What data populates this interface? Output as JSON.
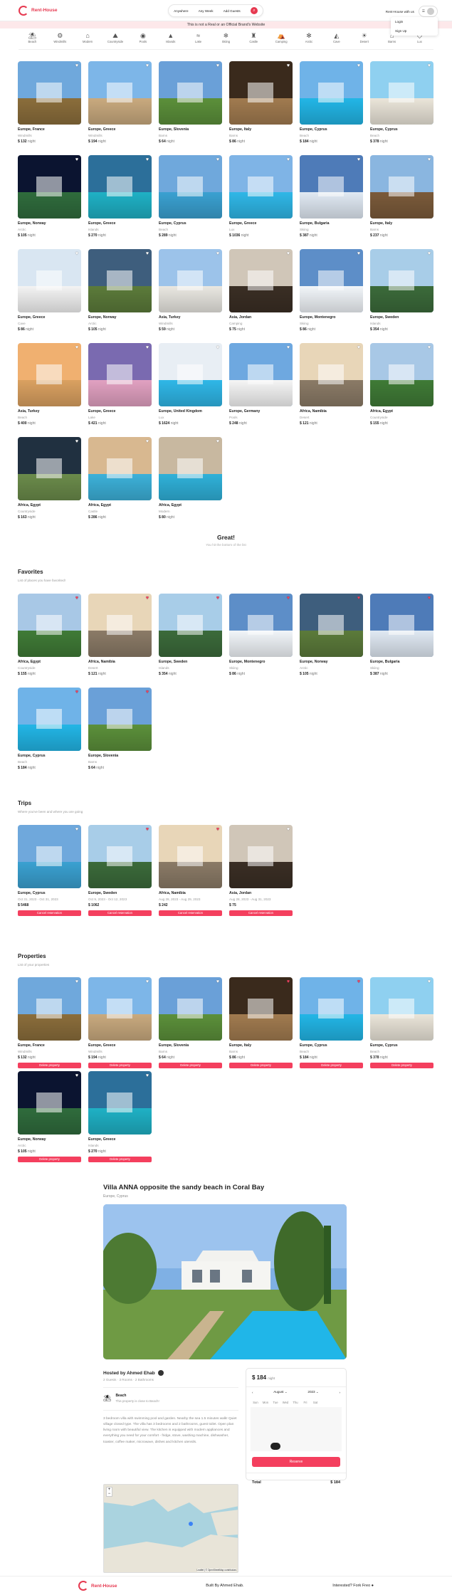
{
  "header": {
    "brand": "Rent-House",
    "search": {
      "where": "Anywhere",
      "when": "Any Week",
      "who": "Add Guests"
    },
    "host_cta": "Rent-House with us",
    "menu": [
      "Login",
      "Sign Up"
    ]
  },
  "banner": "This is not a Real or an Official Brand's Website",
  "categories": [
    "Beach",
    "Windmills",
    "Modern",
    "Countryside",
    "Pools",
    "Islands",
    "Lake",
    "Skiing",
    "Castle",
    "Camping",
    "Arctic",
    "Cave",
    "Desert",
    "Barns",
    "Lux"
  ],
  "listings": [
    {
      "loc": "Europe, France",
      "cat": "Windmills",
      "price": "$ 132"
    },
    {
      "loc": "Europe, Greece",
      "cat": "Windmills",
      "price": "$ 194"
    },
    {
      "loc": "Europe, Slovenia",
      "cat": "Barns",
      "price": "$ 64"
    },
    {
      "loc": "Europe, Italy",
      "cat": "Barns",
      "price": "$ 86"
    },
    {
      "loc": "Europe, Cyprus",
      "cat": "Beach",
      "price": "$ 184"
    },
    {
      "loc": "Europe, Cyprus",
      "cat": "Beach",
      "price": "$ 378"
    },
    {
      "loc": "Europe, Norway",
      "cat": "Arctic",
      "price": "$ 105"
    },
    {
      "loc": "Europe, Greece",
      "cat": "Islands",
      "price": "$ 270"
    },
    {
      "loc": "Europe, Cyprus",
      "cat": "Beach",
      "price": "$ 289"
    },
    {
      "loc": "Europe, Greece",
      "cat": "Lux",
      "price": "$ 1036"
    },
    {
      "loc": "Europe, Bulgaria",
      "cat": "Skiing",
      "price": "$ 387"
    },
    {
      "loc": "Europe, Italy",
      "cat": "Barns",
      "price": "$ 237"
    },
    {
      "loc": "Europe, Greece",
      "cat": "Cave",
      "price": "$ 86"
    },
    {
      "loc": "Europe, Norway",
      "cat": "Arctic",
      "price": "$ 105"
    },
    {
      "loc": "Asia, Turkey",
      "cat": "Windmills",
      "price": "$ 59"
    },
    {
      "loc": "Asia, Jordan",
      "cat": "Camping",
      "price": "$ 75"
    },
    {
      "loc": "Europe, Montenegro",
      "cat": "Skiing",
      "price": "$ 86"
    },
    {
      "loc": "Europe, Sweden",
      "cat": "Islands",
      "price": "$ 354"
    },
    {
      "loc": "Asia, Turkey",
      "cat": "Beach",
      "price": "$ 400"
    },
    {
      "loc": "Europe, Greece",
      "cat": "Lake",
      "price": "$ 421"
    },
    {
      "loc": "Europe, United Kingdom",
      "cat": "Lux",
      "price": "$ 1624"
    },
    {
      "loc": "Europe, Germany",
      "cat": "Pools",
      "price": "$ 248"
    },
    {
      "loc": "Africa, Namibia",
      "cat": "Desert",
      "price": "$ 121"
    },
    {
      "loc": "Africa, Egypt",
      "cat": "Countryside",
      "price": "$ 155"
    },
    {
      "loc": "Africa, Egypt",
      "cat": "Countryside",
      "price": "$ 163"
    },
    {
      "loc": "Africa, Egypt",
      "cat": "Castle",
      "price": "$ 286"
    },
    {
      "loc": "Africa, Egypt",
      "cat": "Modern",
      "price": "$ 80"
    }
  ],
  "night_label": "night",
  "great": {
    "title": "Great!",
    "sub": "You hit the bottom of the list"
  },
  "favorites": {
    "title": "Favorites",
    "sub": "List of places you have favorited!",
    "items": [
      {
        "loc": "Africa, Egypt",
        "cat": "Countryside",
        "price": "$ 155"
      },
      {
        "loc": "Africa, Namibia",
        "cat": "Desert",
        "price": "$ 121"
      },
      {
        "loc": "Europe, Sweden",
        "cat": "Islands",
        "price": "$ 354"
      },
      {
        "loc": "Europe, Montenegro",
        "cat": "Skiing",
        "price": "$ 86"
      },
      {
        "loc": "Europe, Norway",
        "cat": "Arctic",
        "price": "$ 105"
      },
      {
        "loc": "Europe, Bulgaria",
        "cat": "Skiing",
        "price": "$ 387"
      },
      {
        "loc": "Europe, Cyprus",
        "cat": "Beach",
        "price": "$ 184"
      },
      {
        "loc": "Europe, Slovenia",
        "cat": "Barns",
        "price": "$ 64"
      }
    ]
  },
  "trips": {
    "title": "Trips",
    "sub": "Where you've been and where you are going",
    "action": "Cancel reservation",
    "items": [
      {
        "loc": "Europe, Cyprus",
        "dates": "Oct 31, 2023 - Oct 31, 2023",
        "price": "$ 5468"
      },
      {
        "loc": "Europe, Sweden",
        "dates": "Oct 9, 2023 - Oct 12, 2023",
        "price": "$ 1062"
      },
      {
        "loc": "Africa, Namibia",
        "dates": "Aug 28, 2023 - Aug 29, 2023",
        "price": "$ 242"
      },
      {
        "loc": "Asia, Jordan",
        "dates": "Aug 28, 2023 - Aug 31, 2023",
        "price": "$ 75"
      }
    ]
  },
  "properties": {
    "title": "Properties",
    "sub": "List of your properties",
    "action": "Delete property",
    "items": [
      {
        "loc": "Europe, France",
        "cat": "Windmills",
        "price": "$ 132"
      },
      {
        "loc": "Europe, Greece",
        "cat": "Windmills",
        "price": "$ 194"
      },
      {
        "loc": "Europe, Slovenia",
        "cat": "Barns",
        "price": "$ 64"
      },
      {
        "loc": "Europe, Italy",
        "cat": "Barns",
        "price": "$ 86"
      },
      {
        "loc": "Europe, Cyprus",
        "cat": "Beach",
        "price": "$ 184"
      },
      {
        "loc": "Europe, Cyprus",
        "cat": "Beach",
        "price": "$ 378"
      },
      {
        "loc": "Europe, Norway",
        "cat": "Arctic",
        "price": "$ 105"
      },
      {
        "loc": "Europe, Greece",
        "cat": "Islands",
        "price": "$ 270"
      }
    ]
  },
  "listing": {
    "title": "Villa ANNA opposite the sandy beach in Coral Bay",
    "location": "Europe, Cyprus",
    "host": "Hosted by Ahmed Ehab",
    "stats": "2 Guests · 3 Rooms · 2 Bathrooms",
    "category": "Beach",
    "category_desc": "This property is close to Beach!",
    "description": "3 bedroom villa with swimming pool and garden. Nearby the sea 1.5 minutes walk! Quiet village closed type. The villa has 3 bedrooms and 2 bathrooms, guest toilet. Open plan living room with beautiful view. The kitchen is equipped with modern appliances and everything you need for your comfort - fridge, stove, washing machine, dishwasher, toaster, coffee maker, microwave, dishes and kitchen utensils.",
    "price": "$ 184",
    "per": "night",
    "month": "August",
    "year": "2023",
    "days": [
      "Sun",
      "Mon",
      "Tue",
      "Wed",
      "Thu",
      "Fri",
      "Sat"
    ],
    "reserve": "Reserve",
    "total_label": "Total",
    "total": "$ 184",
    "map_credit": "Leaflet | © OpenStreetMap contributors"
  },
  "footer": {
    "brand": "Rent-House",
    "built": "Built By Ahmed Ehab.",
    "cta": "Interested? Fork Freo"
  },
  "colors": {
    "accent": "#f43f5e",
    "brand": "#e63950"
  }
}
